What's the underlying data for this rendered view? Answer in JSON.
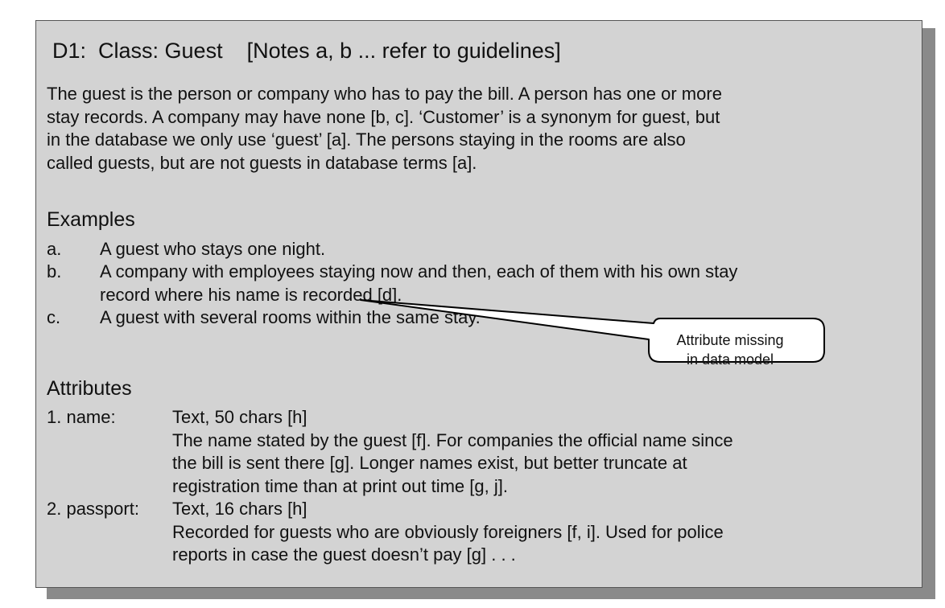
{
  "title": "D1:  Class: Guest    [Notes a, b ... refer to guidelines]",
  "description": [
    "The guest is the person or company who has to pay the bill. A person has one or more",
    "stay records. A company may have none [b, c]. ‘Customer’ is a synonym for guest, but",
    "in the database we only use  ‘guest’ [a]. The persons staying in the rooms are also",
    "called guests, but are not guests in database terms [a]."
  ],
  "examples": {
    "heading": "Examples",
    "items": [
      {
        "label": "a.",
        "lines": [
          "A guest who stays one night."
        ]
      },
      {
        "label": "b.",
        "lines": [
          "A company with employees staying now and then, each of them with his own stay",
          "record where his name is recorded [d]."
        ]
      },
      {
        "label": "c.",
        "lines": [
          "A guest with several rooms within the same stay."
        ]
      }
    ]
  },
  "callout": {
    "line1": "Attribute missing",
    "line2": "in data model"
  },
  "attributes": {
    "heading": "Attributes",
    "items": [
      {
        "label": "1. name:",
        "type": "Text, 50 chars [h]",
        "lines": [
          "The name stated by the guest [f]. For companies the official name since",
          "the bill is sent there [g]. Longer names exist, but better truncate at",
          "registration time than at print out time [g, j]."
        ]
      },
      {
        "label": "2. passport:",
        "type": "Text, 16 chars [h]",
        "lines": [
          "Recorded for guests who are obviously foreigners [f, i]. Used for police",
          "reports in case the guest doesn’t pay [g] . . ."
        ]
      }
    ]
  }
}
